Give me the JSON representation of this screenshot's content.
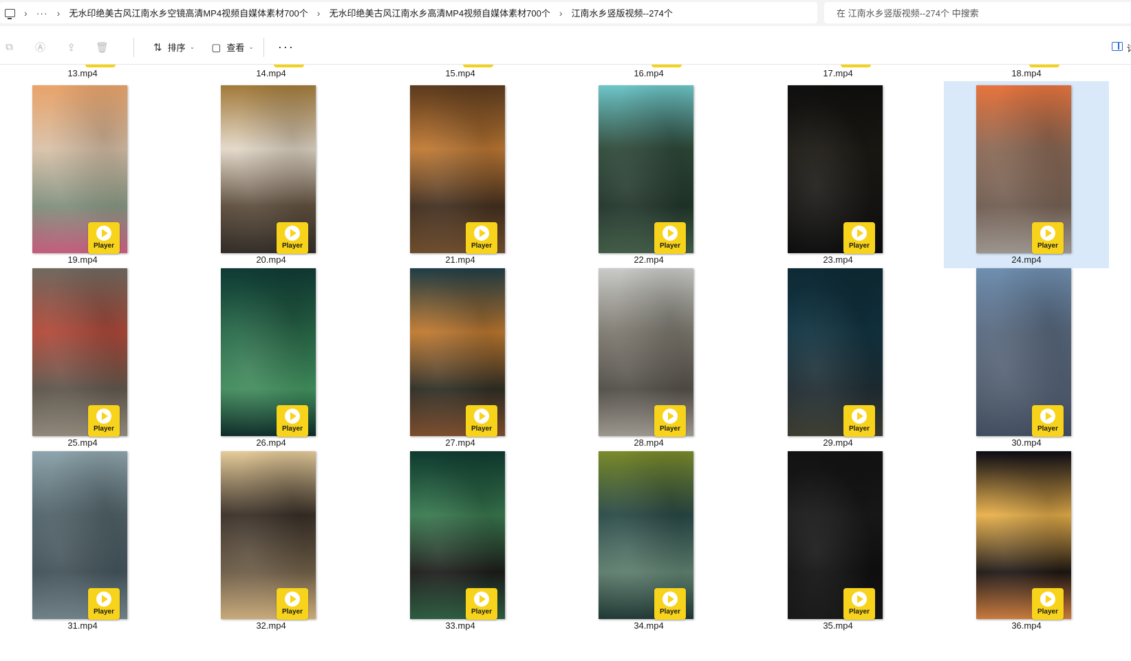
{
  "breadcrumb": {
    "more": "···",
    "items": [
      "无水印绝美古风江南水乡空镜高清MP4视频自媒体素材700个",
      "无水印绝美古风江南水乡高清MP4视频自媒体素材700个",
      "江南水乡竖版视频--274个"
    ]
  },
  "search": {
    "placeholder": "在 江南水乡竖版视频--274个 中搜索"
  },
  "toolbar": {
    "sort_label": "排序",
    "view_label": "查看",
    "more_label": "···",
    "details_label": "详"
  },
  "badge_label": "Player",
  "top_row": [
    "13.mp4",
    "14.mp4",
    "15.mp4",
    "16.mp4",
    "17.mp4",
    "18.mp4"
  ],
  "files": [
    {
      "name": "19.mp4",
      "colors": [
        "#e9a36a",
        "#d9c1a8",
        "#7d8d7a",
        "#c25a7a"
      ],
      "selected": false
    },
    {
      "name": "20.mp4",
      "colors": [
        "#a27a3a",
        "#e3d8c8",
        "#5a4a3a",
        "#2f2a24"
      ],
      "selected": false
    },
    {
      "name": "21.mp4",
      "colors": [
        "#5a3a1e",
        "#c07a34",
        "#3e2b1c",
        "#6b4a2a"
      ],
      "selected": false
    },
    {
      "name": "22.mp4",
      "colors": [
        "#6ec6c9",
        "#2f4a3a",
        "#1f3228",
        "#3f5a44"
      ],
      "selected": false
    },
    {
      "name": "23.mp4",
      "colors": [
        "#0f0f0f",
        "#1d1a14",
        "#141311",
        "#0b0b0b"
      ],
      "selected": false
    },
    {
      "name": "24.mp4",
      "colors": [
        "#e7743e",
        "#8c6a56",
        "#6e5a4e",
        "#9a938c"
      ],
      "selected": true
    },
    {
      "name": "25.mp4",
      "colors": [
        "#6f6a60",
        "#b24a3a",
        "#5a5248",
        "#8e8678"
      ],
      "selected": false
    },
    {
      "name": "26.mp4",
      "colors": [
        "#0f3a34",
        "#2a6a4a",
        "#3f8a5a",
        "#0c2a26"
      ],
      "selected": false
    },
    {
      "name": "27.mp4",
      "colors": [
        "#1f3d46",
        "#c07a30",
        "#2b2a22",
        "#7a4a2a"
      ],
      "selected": false
    },
    {
      "name": "28.mp4",
      "colors": [
        "#c9cbc8",
        "#7e7a70",
        "#4e4a44",
        "#9a968c"
      ],
      "selected": false
    },
    {
      "name": "29.mp4",
      "colors": [
        "#0e2a35",
        "#123543",
        "#1d2a30",
        "#3a3a2e"
      ],
      "selected": false
    },
    {
      "name": "30.mp4",
      "colors": [
        "#6f8fb0",
        "#5a6a80",
        "#4e5a6c",
        "#3f4a5c"
      ],
      "selected": false
    },
    {
      "name": "31.mp4",
      "colors": [
        "#8fa5ad",
        "#52646a",
        "#3f4f55",
        "#6d7f85"
      ],
      "selected": false
    },
    {
      "name": "32.mp4",
      "colors": [
        "#e6cc9a",
        "#3a3028",
        "#6a5a44",
        "#c8a878"
      ],
      "selected": false
    },
    {
      "name": "33.mp4",
      "colors": [
        "#0f3a30",
        "#3a7a50",
        "#1a1a18",
        "#2a5a3e"
      ],
      "selected": false
    },
    {
      "name": "34.mp4",
      "colors": [
        "#7a8a2a",
        "#2a4a48",
        "#5a7a6a",
        "#1e3632"
      ],
      "selected": false
    },
    {
      "name": "35.mp4",
      "colors": [
        "#121212",
        "#1a1a1a",
        "#0e0e0e",
        "#161616"
      ],
      "selected": false
    },
    {
      "name": "36.mp4",
      "colors": [
        "#0a0a14",
        "#e8b04a",
        "#1a1412",
        "#c8783a"
      ],
      "selected": false
    }
  ]
}
